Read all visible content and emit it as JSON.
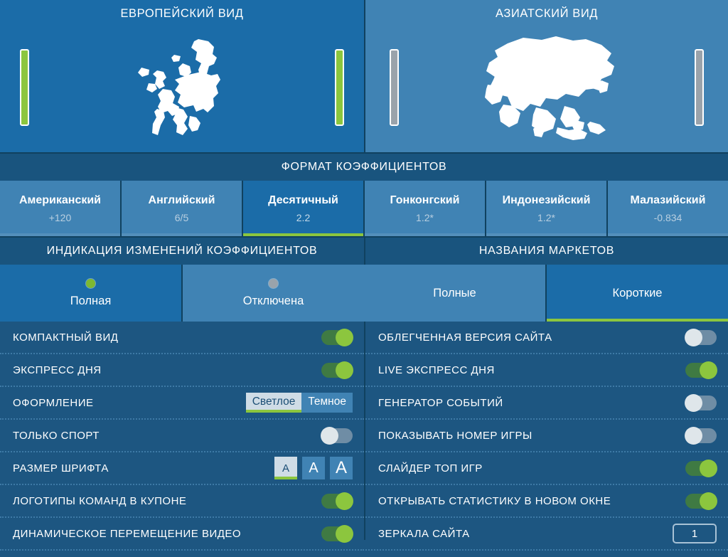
{
  "views": {
    "panels": [
      {
        "title": "ЕВРОПЕЙСКИЙ ВИД",
        "map": "europe-map",
        "selected": true,
        "bar_state": "green"
      },
      {
        "title": "АЗИАТСКИЙ ВИД",
        "map": "asia-map",
        "selected": false,
        "bar_state": "grey"
      }
    ]
  },
  "odds_format": {
    "header": "ФОРМАТ КОЭФФИЦИЕНТОВ",
    "tabs": [
      {
        "name": "Американский",
        "value": "+120",
        "selected": false
      },
      {
        "name": "Английский",
        "value": "6/5",
        "selected": false
      },
      {
        "name": "Десятичный",
        "value": "2.2",
        "selected": true
      },
      {
        "name": "Гонконгский",
        "value": "1.2*",
        "selected": false
      },
      {
        "name": "Индонезийский",
        "value": "1.2*",
        "selected": false
      },
      {
        "name": "Малазийский",
        "value": "-0.834",
        "selected": false
      }
    ]
  },
  "odds_change_indication": {
    "header": "ИНДИКАЦИЯ ИЗМЕНЕНИЙ КОЭФФИЦИЕНТОВ",
    "tabs": [
      {
        "label": "Полная",
        "dot": "green",
        "selected": true
      },
      {
        "label": "Отключена",
        "dot": "grey",
        "selected": false
      }
    ]
  },
  "market_names": {
    "header": "НАЗВАНИЯ МАРКЕТОВ",
    "tabs": [
      {
        "label": "Полные",
        "selected": false
      },
      {
        "label": "Короткие",
        "selected": true
      }
    ]
  },
  "settings": {
    "left": [
      {
        "label": "КОМПАКТНЫЙ ВИД",
        "control": "toggle",
        "state": "on"
      },
      {
        "label": "ЭКСПРЕСС ДНЯ",
        "control": "toggle",
        "state": "on"
      },
      {
        "label": "ОФОРМЛЕНИЕ",
        "control": "segmented",
        "options": [
          "Светлое",
          "Темное"
        ],
        "selected": "Светлое"
      },
      {
        "label": "ТОЛЬКО СПОРТ",
        "control": "toggle",
        "state": "off"
      },
      {
        "label": "РАЗМЕР ШРИФТА",
        "control": "fontsize",
        "options": [
          "A",
          "A",
          "A"
        ],
        "selected_index": 0
      },
      {
        "label": "ЛОГОТИПЫ КОМАНД В КУПОНЕ",
        "control": "toggle",
        "state": "on"
      },
      {
        "label": "ДИНАМИЧЕСКОЕ ПЕРЕМЕЩЕНИЕ ВИДЕО",
        "control": "toggle",
        "state": "on"
      }
    ],
    "right": [
      {
        "label": "ОБЛЕГЧЕННАЯ ВЕРСИЯ САЙТА",
        "control": "toggle",
        "state": "off"
      },
      {
        "label": "LIVE ЭКСПРЕСС ДНЯ",
        "control": "toggle",
        "state": "on"
      },
      {
        "label": "ГЕНЕРАТОР СОБЫТИЙ",
        "control": "toggle",
        "state": "off"
      },
      {
        "label": "ПОКАЗЫВАТЬ НОМЕР ИГРЫ",
        "control": "toggle",
        "state": "off"
      },
      {
        "label": "СЛАЙДЕР ТОП ИГР",
        "control": "toggle",
        "state": "on"
      },
      {
        "label": "ОТКРЫВАТЬ СТАТИСТИКУ В НОВОМ ОКНЕ",
        "control": "toggle",
        "state": "on"
      },
      {
        "label": "ЗЕРКАЛА САЙТА",
        "control": "stepper",
        "value": "1"
      }
    ]
  },
  "colors": {
    "accent_green": "#8cc63e",
    "panel_selected": "#1b6ca8",
    "panel_unselected": "#4083b4",
    "header_bar": "#19547e",
    "row_bg": "#1d5681"
  }
}
